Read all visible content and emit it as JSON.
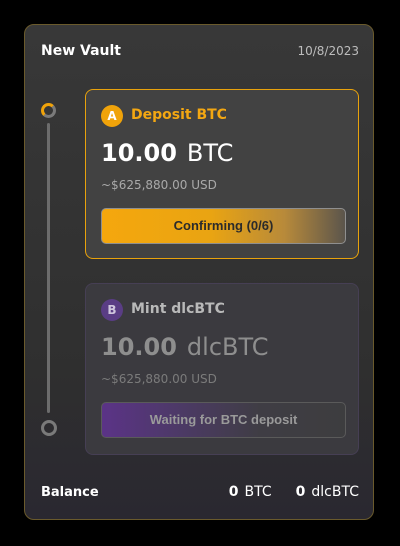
{
  "vault": {
    "title": "New Vault",
    "date": "10/8/2023"
  },
  "steps": [
    {
      "badge": "A",
      "title": "Deposit BTC",
      "amount": "10.00",
      "unit": "BTC",
      "usd": "~$625,880.00 USD",
      "status": "Confirming (0/6)"
    },
    {
      "badge": "B",
      "title": "Mint dlcBTC",
      "amount": "10.00",
      "unit": "dlcBTC",
      "usd": "~$625,880.00 USD",
      "status": "Waiting for BTC deposit"
    }
  ],
  "balance": {
    "label": "Balance",
    "btc_value": "0",
    "btc_unit": "BTC",
    "dlcbtc_value": "0",
    "dlcbtc_unit": "dlcBTC"
  },
  "colors": {
    "accent": "#f0a30a",
    "secondary": "#5a3d85",
    "card_border": "#6a5a2c"
  },
  "icons": {
    "progress_start": "progress-ring-icon",
    "progress_end": "progress-ring-empty-icon"
  }
}
